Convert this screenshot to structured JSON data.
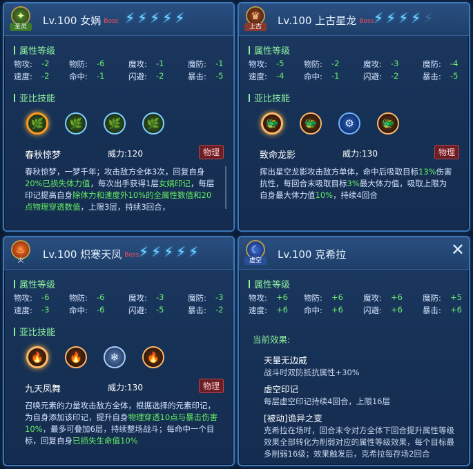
{
  "common": {
    "attr_title": "属性等级",
    "skill_title": "亚比技能",
    "bolt_icon": "⚡",
    "stat_labels": [
      "物攻:",
      "物防:",
      "魔攻:",
      "魔防:",
      "速度:",
      "命中:",
      "闪避:",
      "暴击:"
    ],
    "physical_badge": "物理"
  },
  "panels": [
    {
      "badge_tag": "圣灵",
      "level": "Lv.100",
      "name": "女娲",
      "boss": "Boss",
      "stars_total": 5,
      "stars_lit": 5,
      "stats": [
        "-2",
        "-6",
        "-1",
        "-1",
        "-2",
        "-1",
        "-2",
        "-5"
      ],
      "skill_name": "春秋惊梦",
      "power": "威力:120",
      "desc_parts": [
        {
          "t": "春秋惊梦，一梦千年；攻击敌方全体3次，回复自身",
          "g": false
        },
        {
          "t": "20%已损失体力值",
          "g": true
        },
        {
          "t": "，每次出手获得1层",
          "g": false
        },
        {
          "t": "女娲印记",
          "g": true
        },
        {
          "t": "，每层印记提高自身",
          "g": false
        },
        {
          "t": "除体力和速度外10%的全属性数值和20点物理穿透数值",
          "g": true
        },
        {
          "t": "，上限3层，持续3回合，",
          "g": false
        }
      ]
    },
    {
      "badge_tag": "上古",
      "level": "Lv.100",
      "name": "上古星龙",
      "boss": "Boss",
      "stars_total": 5,
      "stars_lit": 4,
      "stats": [
        "-5",
        "-2",
        "-3",
        "-4",
        "-4",
        "-1",
        "-2",
        "-5"
      ],
      "skill_name": "致命龙影",
      "power": "威力:130",
      "desc_parts": [
        {
          "t": "挥出星空龙影攻击敌方单体，命中后吸取目标",
          "g": false
        },
        {
          "t": "13%",
          "g": true
        },
        {
          "t": "伤害抗性，每回合末吸取目标",
          "g": false
        },
        {
          "t": "3%",
          "g": true
        },
        {
          "t": "最大体力值，吸取上限为自身最大体力值",
          "g": false
        },
        {
          "t": "10%",
          "g": true
        },
        {
          "t": "，持续4回合",
          "g": false
        }
      ]
    },
    {
      "badge_tag": "火",
      "level": "Lv.100",
      "name": "炽寒天凤",
      "boss": "Boss",
      "stars_total": 5,
      "stars_lit": 5,
      "stats": [
        "-6",
        "-6",
        "-3",
        "-3",
        "-3",
        "-6",
        "-5",
        "-2"
      ],
      "skill_name": "九天凤舞",
      "power": "威力:130",
      "desc_parts": [
        {
          "t": "召唤元素的力量攻击敌方全体，根据选择的元素印记，为自身添加该印记，提升自身",
          "g": false
        },
        {
          "t": "物理穿透10点与暴击伤害10%",
          "g": true
        },
        {
          "t": "，最多可叠加6层，持续整场战斗；每命中一个目标，回复自身",
          "g": false
        },
        {
          "t": "已损失生命值10%",
          "g": true
        }
      ]
    },
    {
      "badge_tag": "虚空",
      "level": "Lv.100",
      "name": "克希拉",
      "stats": [
        "+6",
        "+6",
        "+6",
        "+5",
        "+6",
        "+6",
        "+6",
        "+6"
      ],
      "effects_title": "当前效果:",
      "close_icon": "✕",
      "effects": [
        {
          "name": "天量无边威",
          "desc": "战斗时双防抵抗属性+30%"
        },
        {
          "name": "虚空印记",
          "desc": "每层虚空印记持续4回合，上限16层"
        },
        {
          "name": "[被动]诡异之变",
          "desc": "克希拉在场时，回合末令对方全体下回合提升属性等级效果全部转化为削弱对应的属性等级效果，每个目标最多削弱16级；效果触发后，克希拉每存场2回合"
        }
      ]
    }
  ]
}
